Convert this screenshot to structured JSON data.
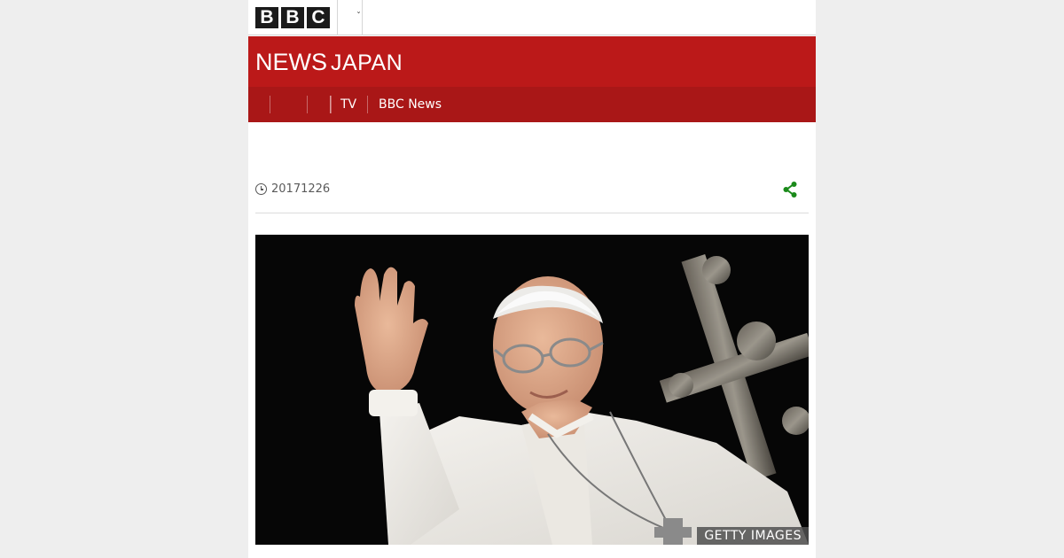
{
  "masthead": {
    "logo_letters": [
      "B",
      "B",
      "C"
    ]
  },
  "header": {
    "brand_word1": "NEWS",
    "brand_word2": "JAPAN"
  },
  "nav": {
    "items": [
      {
        "label": ""
      },
      {
        "label": ""
      },
      {
        "label": ""
      },
      {
        "label": "TV"
      },
      {
        "label": "BBC News"
      }
    ]
  },
  "article": {
    "date": "20171226",
    "image": {
      "credit": "GETTY IMAGES"
    }
  },
  "colors": {
    "header_red": "#bb1919",
    "nav_red": "#a91717",
    "share_green": "#1a8a1a"
  },
  "icons": {
    "date": "clock-icon",
    "share": "share-icon",
    "more": "chevron-down-icon"
  }
}
